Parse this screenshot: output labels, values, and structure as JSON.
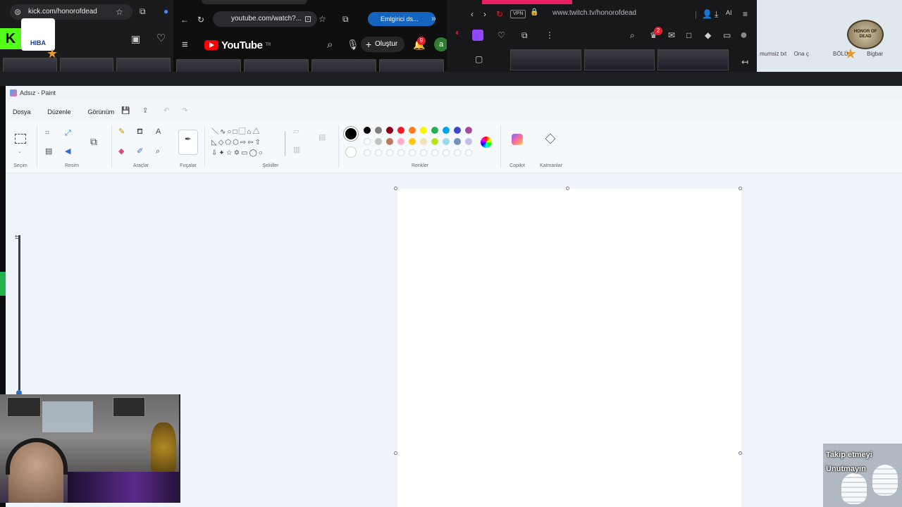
{
  "browser1": {
    "url": "kick.com/honorofdead",
    "kick_letter": "K",
    "logo_text": "HIBA"
  },
  "browser2": {
    "url": "youtube.com/watch?...",
    "pill": "Emlgirici ds...",
    "brand": "YouTube",
    "brand_sup": "TR",
    "create_label": "Oluştur",
    "notif_count": "9",
    "avatar_letter": "a"
  },
  "browser3": {
    "url": "www.twitch.tv/honorofdead",
    "vpn": "VPN",
    "notif_count": "2",
    "ai_label": "AI"
  },
  "browser4": {
    "seal_text": "HONOR OF DEAD",
    "tabs": [
      "mumsiz txt",
      "Ona ç",
      "BÖLÜ",
      "Bigbar"
    ]
  },
  "paint": {
    "title": "Adsız - Paint",
    "menu": [
      "Dosya",
      "Düzenle",
      "Görünüm"
    ],
    "groups": {
      "selection": "Seçim",
      "image": "Resim",
      "tools": "Araçlar",
      "brushes": "Fırçalar",
      "shapes": "Şekiller",
      "colors": "Renkler",
      "copilot": "Copilot",
      "layers": "Katmanlar"
    },
    "palette_row1": [
      "#000000",
      "#7f7f7f",
      "#880015",
      "#ed1c24",
      "#ff7f27",
      "#fff200",
      "#22b14c",
      "#00a2e8",
      "#3f48cc",
      "#a349a4"
    ],
    "palette_row2": [
      "#ffffff",
      "#c3c3c3",
      "#b97a57",
      "#ffaec9",
      "#ffc90e",
      "#efe4b0",
      "#b5e61d",
      "#99d9ea",
      "#7092be",
      "#c8bfe7"
    ],
    "primary_color": "#000000",
    "secondary_color": "#ffffff"
  },
  "overlay": {
    "follow_text": "Takip etmeyi\nUnutmayın"
  }
}
